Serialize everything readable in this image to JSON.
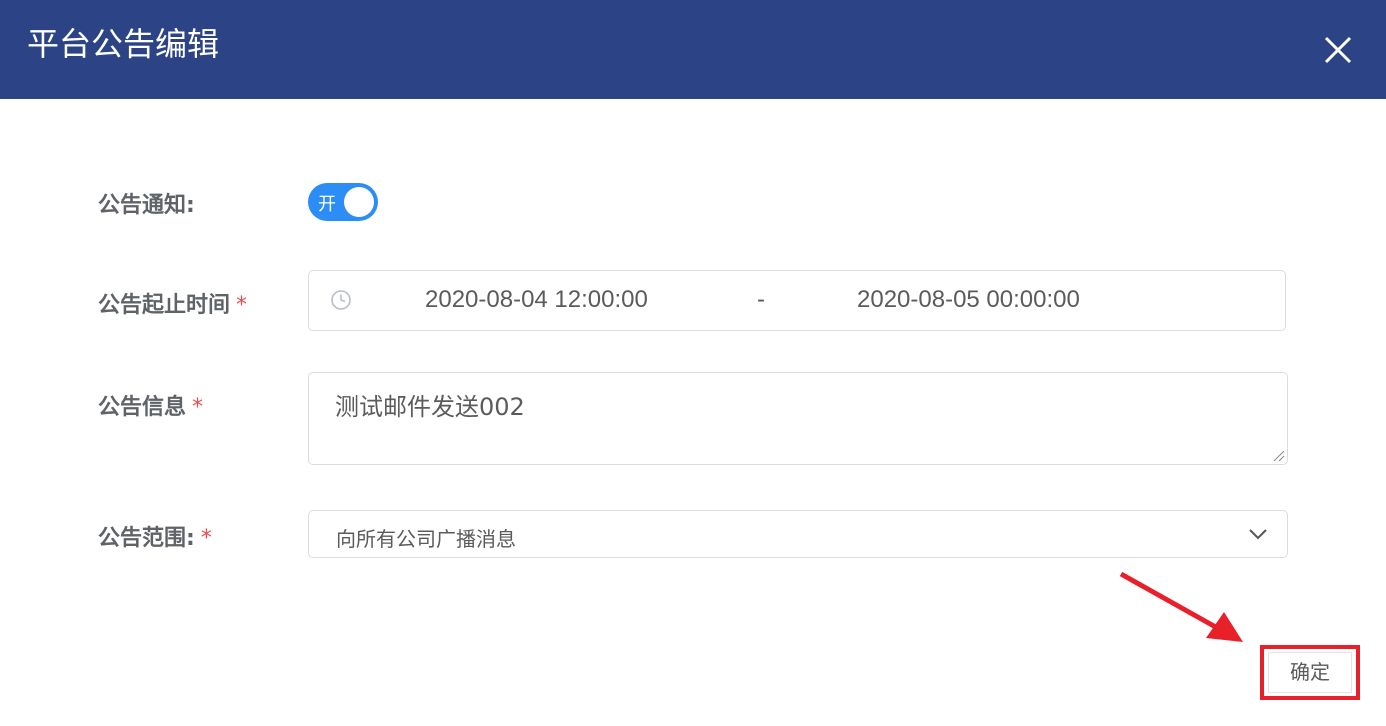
{
  "header": {
    "title": "平台公告编辑",
    "close_icon": "close-icon",
    "background_color": "#2c4486"
  },
  "form": {
    "notify": {
      "label": "公告通知:",
      "toggle_text": "开",
      "toggle_on": true,
      "toggle_color": "#2b8df5"
    },
    "time_range": {
      "label": "公告起止时间",
      "required_mark": "*",
      "icon": "clock-icon",
      "start": "2020-08-04 12:00:00",
      "separator": "-",
      "end": "2020-08-05 00:00:00"
    },
    "message": {
      "label": "公告信息",
      "required_mark": "*",
      "value": "测试邮件发送002"
    },
    "scope": {
      "label": "公告范围:",
      "required_mark": "*",
      "selected": "向所有公司广播消息",
      "icon": "chevron-down-icon"
    }
  },
  "footer": {
    "confirm_label": "确定",
    "annotation_color": "#e8202a"
  }
}
